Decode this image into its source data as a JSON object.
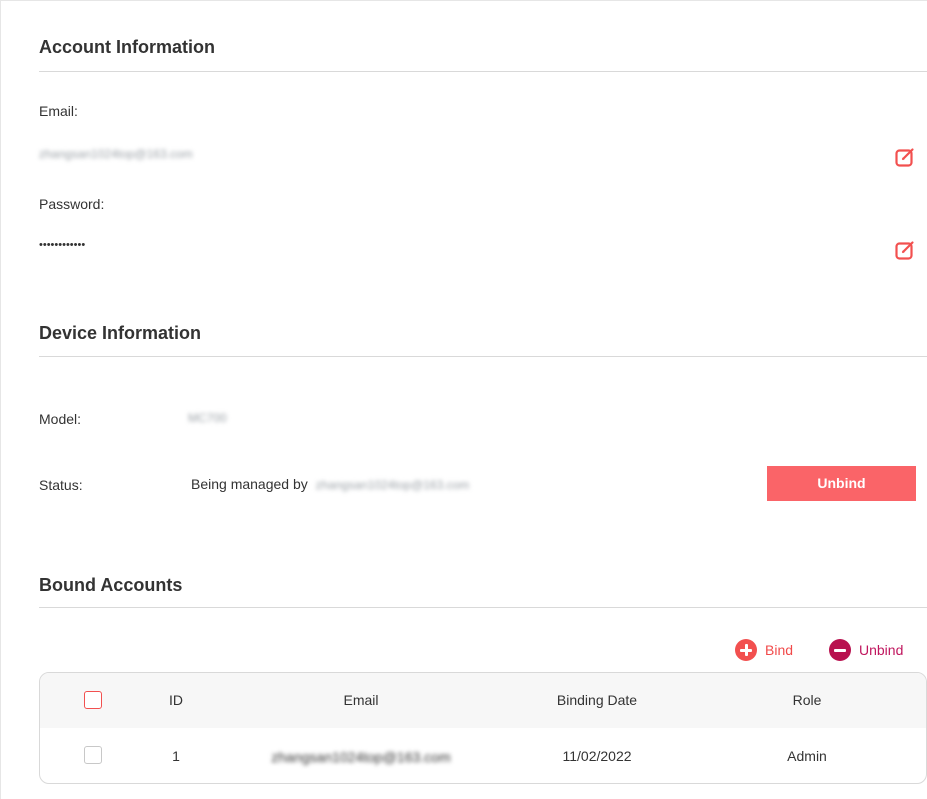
{
  "account": {
    "title": "Account Information",
    "email_label": "Email:",
    "email_value": "zhangsan1024top@163.com",
    "password_label": "Password:",
    "password_value": "••••••••••••"
  },
  "device": {
    "title": "Device Information",
    "model_label": "Model:",
    "model_value": "MC700",
    "status_label": "Status:",
    "status_prefix": "Being managed by",
    "status_account": "zhangsan1024top@163.com",
    "unbind_button": "Unbind"
  },
  "bound": {
    "title": "Bound Accounts",
    "bind_action": "Bind",
    "unbind_action": "Unbind",
    "columns": [
      "ID",
      "Email",
      "Binding Date",
      "Role"
    ],
    "rows": [
      {
        "id": "1",
        "email": "zhangsan1024top@163.com",
        "date": "11/02/2022",
        "role": "Admin"
      }
    ]
  },
  "colors": {
    "accent": "#fa6468",
    "bind_icon": "#f2504f",
    "unbind_icon": "#b8114f"
  },
  "icons": {
    "edit": "edit-icon",
    "add": "add-circle-icon",
    "remove": "remove-circle-icon"
  }
}
